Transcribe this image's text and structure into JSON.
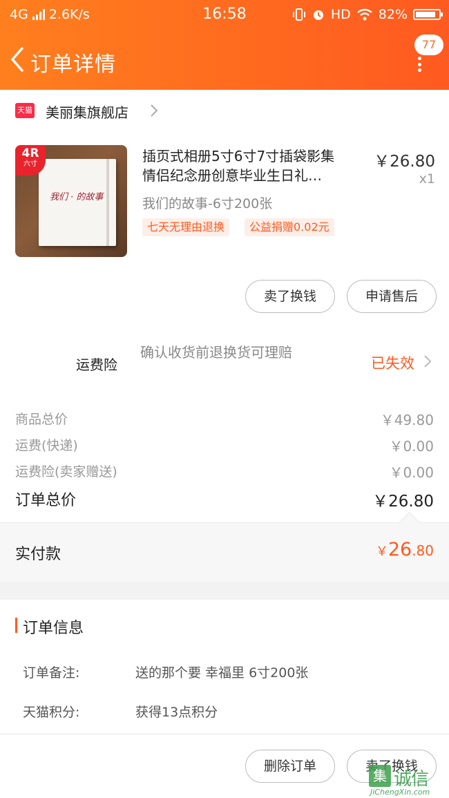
{
  "status_bar": {
    "network": "4G",
    "speed": "2.6K/s",
    "time": "16:58",
    "hd": "HD",
    "battery": "82%"
  },
  "header": {
    "title": "订单详情",
    "message_count": "77"
  },
  "store": {
    "badge": "天猫",
    "name": "美丽集旗舰店"
  },
  "product": {
    "badge_main": "4R",
    "badge_sub": "六寸",
    "title_line1": "插页式相册5寸6寸7寸插袋影集",
    "title_line2": "情侣纪念册创意毕业生日礼…",
    "price": "￥26.80",
    "quantity": "x1",
    "sku": "我们的故事-6寸200张",
    "tags": [
      "七天无理由退换",
      "公益捐赠0.02元"
    ],
    "cover_script": "我们 · 的故事"
  },
  "actions_top": {
    "sell": "卖了换钱",
    "after_sale": "申请售后"
  },
  "insurance": {
    "title": "运费险",
    "desc": "确认收货前退换货可理赔",
    "status": "已失效"
  },
  "summary": {
    "rows": [
      {
        "label": "商品总价",
        "value": "￥49.80"
      },
      {
        "label": "运费(快递)",
        "value": "￥0.00"
      },
      {
        "label": "运费险(卖家赠送)",
        "value": "￥0.00"
      }
    ],
    "total_label": "订单总价",
    "total_value": "￥26.80",
    "paid_label": "实付款",
    "paid_currency": "￥",
    "paid_int": "26",
    "paid_dec": ".80"
  },
  "order_info": {
    "title": "订单信息",
    "rows": [
      {
        "label": "订单备注:",
        "value": "送的那个要   幸福里    6寸200张"
      },
      {
        "label": "天猫积分:",
        "value": "获得13点积分"
      }
    ]
  },
  "actions_bottom": {
    "delete": "删除订单",
    "sell": "卖了换钱"
  },
  "watermark": {
    "logo": "集",
    "cn": "诚信",
    "en": "JiChengXin.com"
  },
  "colors": {
    "accent": "#ff5a1f",
    "header_start": "#ff7f1e",
    "header_end": "#ff5a20"
  }
}
